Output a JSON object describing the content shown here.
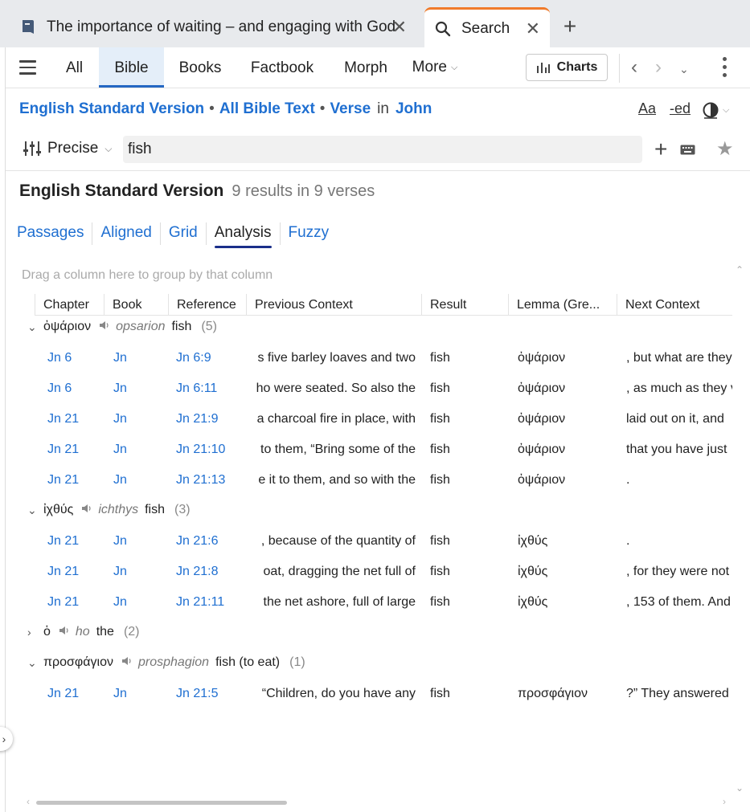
{
  "tabs": {
    "doc_title": "The importance of waiting – and engaging with God",
    "search_title": "Search",
    "close_glyph": "✕",
    "new_tab_glyph": "+"
  },
  "toolbar": {
    "nav_tabs": [
      "All",
      "Bible",
      "Books",
      "Factbook",
      "Morph",
      "More"
    ],
    "active_tab": "Bible",
    "charts_label": "Charts"
  },
  "scope": {
    "version": "English Standard Version",
    "range": "All Bible Text",
    "unit": "Verse",
    "in_word": "in",
    "book": "John",
    "font_btn": "Aa",
    "ed_btn": "-ed"
  },
  "search": {
    "mode": "Precise",
    "query": "fish"
  },
  "results": {
    "version": "English Standard Version",
    "summary": "9 results in 9 verses"
  },
  "view_tabs": [
    "Passages",
    "Aligned",
    "Grid",
    "Analysis",
    "Fuzzy"
  ],
  "active_view": "Analysis",
  "grid": {
    "group_hint": "Drag a column here to group by that column",
    "columns": [
      "Chapter",
      "Book",
      "Reference",
      "Previous Context",
      "Result",
      "Lemma (Gre...",
      "Next Context"
    ],
    "groups": [
      {
        "lemma": "ὀψάριον",
        "translit": "opsarion",
        "gloss": "fish",
        "count": "(5)",
        "expanded": true,
        "rows": [
          {
            "chapter": "Jn 6",
            "book": "Jn",
            "reference": "Jn 6:9",
            "prev": "s five barley loaves and two",
            "result": "fish",
            "lemma": "ὀψάριον",
            "next": ", but what are they"
          },
          {
            "chapter": "Jn 6",
            "book": "Jn",
            "reference": "Jn 6:11",
            "prev": "ho were seated. So also the",
            "result": "fish",
            "lemma": "ὀψάριον",
            "next": ", as much as they v"
          },
          {
            "chapter": "Jn 21",
            "book": "Jn",
            "reference": "Jn 21:9",
            "prev": "a charcoal fire in place, with",
            "result": "fish",
            "lemma": "ὀψάριον",
            "next": "laid out on it, and"
          },
          {
            "chapter": "Jn 21",
            "book": "Jn",
            "reference": "Jn 21:10",
            "prev": "to them, “Bring some of the",
            "result": "fish",
            "lemma": "ὀψάριον",
            "next": "that you have just"
          },
          {
            "chapter": "Jn 21",
            "book": "Jn",
            "reference": "Jn 21:13",
            "prev": "e it to them, and so with the",
            "result": "fish",
            "lemma": "ὀψάριον",
            "next": "."
          }
        ]
      },
      {
        "lemma": "ἰχθύς",
        "translit": "ichthys",
        "gloss": "fish",
        "count": "(3)",
        "expanded": true,
        "rows": [
          {
            "chapter": "Jn 21",
            "book": "Jn",
            "reference": "Jn 21:6",
            "prev": ", because of the quantity of",
            "result": "fish",
            "lemma": "ἰχθύς",
            "next": "."
          },
          {
            "chapter": "Jn 21",
            "book": "Jn",
            "reference": "Jn 21:8",
            "prev": "oat, dragging the net full of",
            "result": "fish",
            "lemma": "ἰχθύς",
            "next": ", for they were not"
          },
          {
            "chapter": "Jn 21",
            "book": "Jn",
            "reference": "Jn 21:11",
            "prev": "the net ashore, full of large",
            "result": "fish",
            "lemma": "ἰχθύς",
            "next": ", 153 of them. And"
          }
        ]
      },
      {
        "lemma": "ὁ",
        "translit": "ho",
        "gloss": "the",
        "count": "(2)",
        "expanded": false,
        "rows": []
      },
      {
        "lemma": "προσφάγιον",
        "translit": "prosphagion",
        "gloss": "fish (to eat)",
        "count": "(1)",
        "expanded": true,
        "rows": [
          {
            "chapter": "Jn 21",
            "book": "Jn",
            "reference": "Jn 21:5",
            "prev": "“Children, do you have any",
            "result": "fish",
            "lemma": "προσφάγιον",
            "next": "?” They answered"
          }
        ]
      }
    ]
  },
  "colors": {
    "link": "#1f6fd1",
    "active_tab_bg": "#e4eef9",
    "search_tab_accent": "#f07a2a",
    "analysis_underline": "#1a2f8a"
  }
}
